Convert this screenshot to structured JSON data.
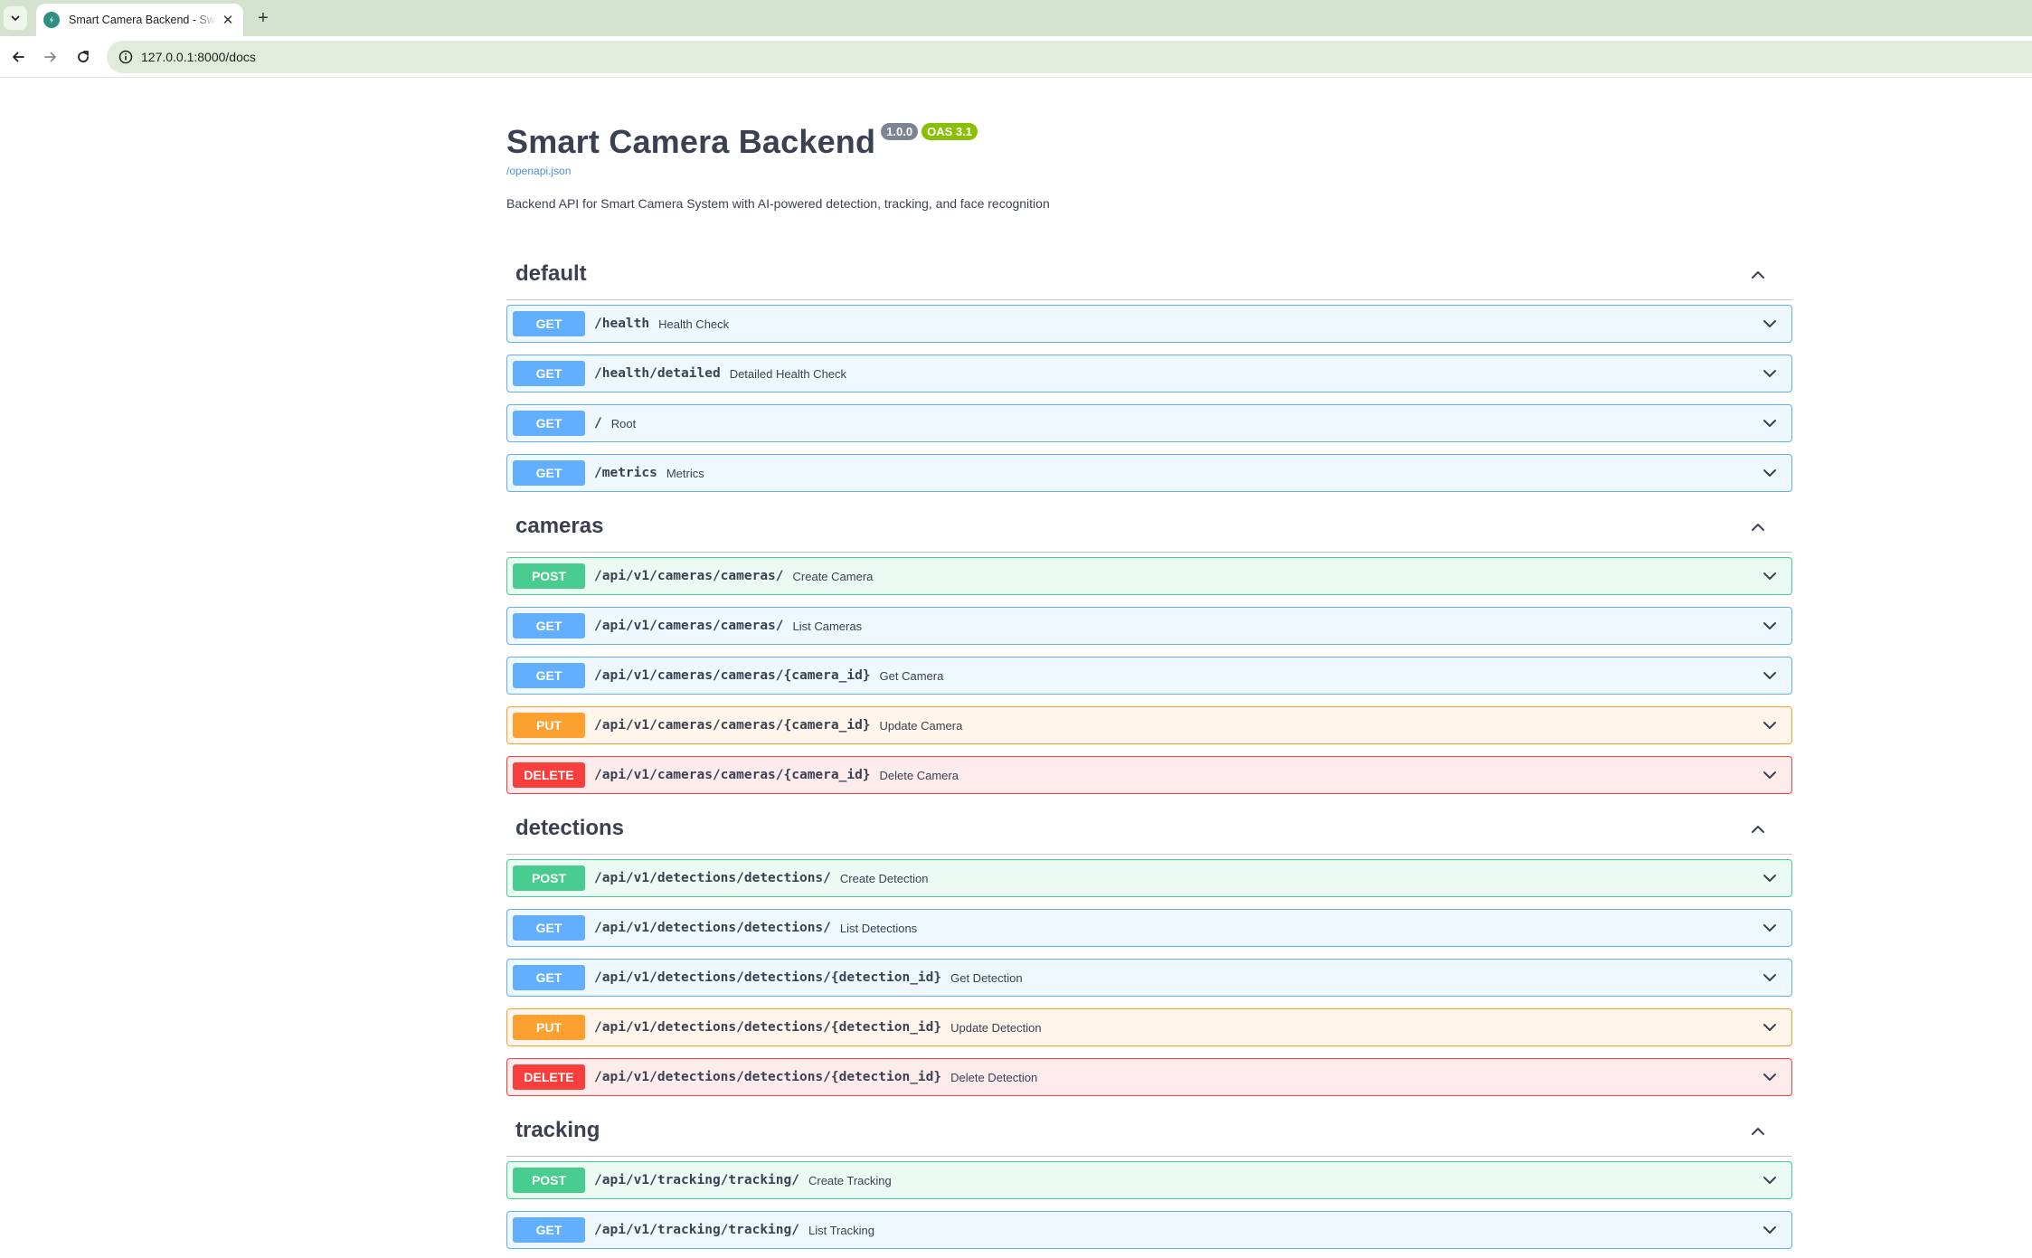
{
  "browser": {
    "tab_title": "Smart Camera Backend - Swagger UI",
    "new_tab_label": "+",
    "close_label": "✕",
    "url": "127.0.0.1:8000/docs"
  },
  "info": {
    "title": "Smart Camera Backend",
    "version": "1.0.0",
    "oas": "OAS 3.1",
    "spec_link": "/openapi.json",
    "description": "Backend API for Smart Camera System with AI-powered detection, tracking, and face recognition"
  },
  "colors": {
    "get": "#61affe",
    "post": "#49cc90",
    "put": "#fca130",
    "delete": "#f93e3e"
  },
  "sections": [
    {
      "name": "default",
      "operations": [
        {
          "method": "GET",
          "path": "/health",
          "summary": "Health Check"
        },
        {
          "method": "GET",
          "path": "/health/detailed",
          "summary": "Detailed Health Check"
        },
        {
          "method": "GET",
          "path": "/",
          "summary": "Root"
        },
        {
          "method": "GET",
          "path": "/metrics",
          "summary": "Metrics"
        }
      ]
    },
    {
      "name": "cameras",
      "operations": [
        {
          "method": "POST",
          "path": "/api/v1/cameras/cameras/",
          "summary": "Create Camera"
        },
        {
          "method": "GET",
          "path": "/api/v1/cameras/cameras/",
          "summary": "List Cameras"
        },
        {
          "method": "GET",
          "path": "/api/v1/cameras/cameras/{camera_id}",
          "summary": "Get Camera"
        },
        {
          "method": "PUT",
          "path": "/api/v1/cameras/cameras/{camera_id}",
          "summary": "Update Camera"
        },
        {
          "method": "DELETE",
          "path": "/api/v1/cameras/cameras/{camera_id}",
          "summary": "Delete Camera"
        }
      ]
    },
    {
      "name": "detections",
      "operations": [
        {
          "method": "POST",
          "path": "/api/v1/detections/detections/",
          "summary": "Create Detection"
        },
        {
          "method": "GET",
          "path": "/api/v1/detections/detections/",
          "summary": "List Detections"
        },
        {
          "method": "GET",
          "path": "/api/v1/detections/detections/{detection_id}",
          "summary": "Get Detection"
        },
        {
          "method": "PUT",
          "path": "/api/v1/detections/detections/{detection_id}",
          "summary": "Update Detection"
        },
        {
          "method": "DELETE",
          "path": "/api/v1/detections/detections/{detection_id}",
          "summary": "Delete Detection"
        }
      ]
    },
    {
      "name": "tracking",
      "operations": [
        {
          "method": "POST",
          "path": "/api/v1/tracking/tracking/",
          "summary": "Create Tracking"
        },
        {
          "method": "GET",
          "path": "/api/v1/tracking/tracking/",
          "summary": "List Tracking"
        }
      ]
    }
  ]
}
